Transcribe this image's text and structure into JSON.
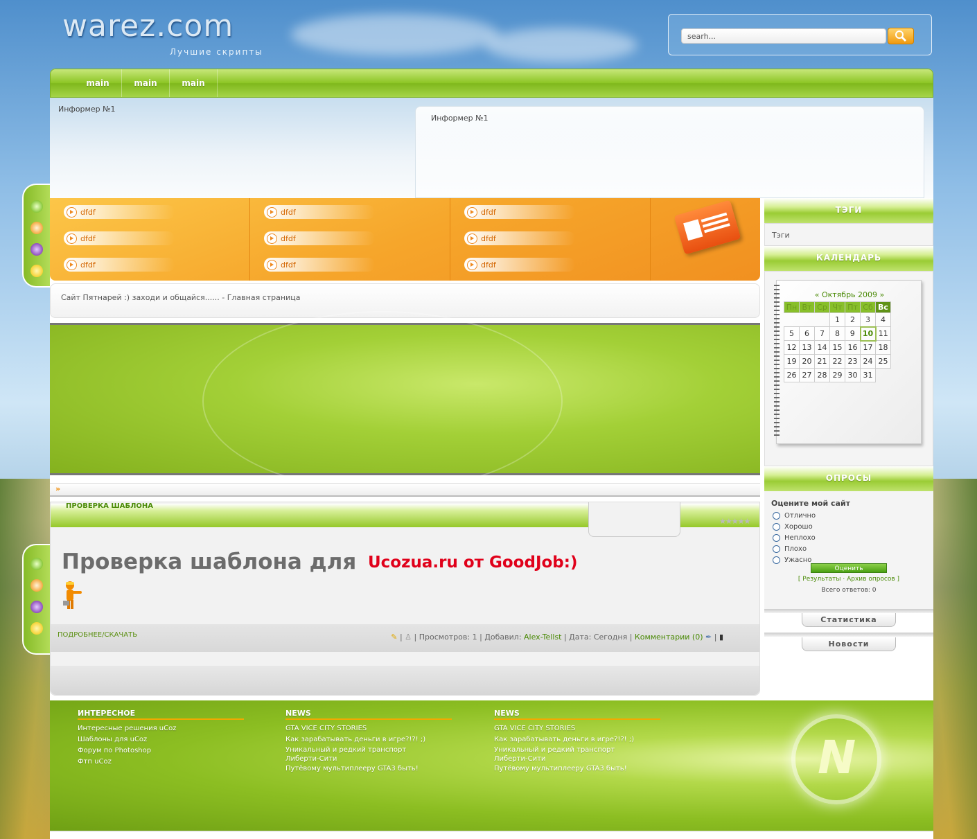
{
  "header": {
    "logo_text": "warez.com",
    "tagline": "Лучшие скрипты",
    "search_placeholder": "searh..."
  },
  "nav": {
    "items": [
      {
        "label": "main"
      },
      {
        "label": "main"
      },
      {
        "label": "main"
      }
    ]
  },
  "banner": {
    "informer_left": "Информер №1",
    "informer_right": "Информер №1"
  },
  "quick_links": {
    "columns": [
      [
        "dfdf",
        "dfdf",
        "dfdf"
      ],
      [
        "dfdf",
        "dfdf",
        "dfdf"
      ],
      [
        "dfdf",
        "dfdf",
        "dfdf"
      ]
    ]
  },
  "breadcrumb": "Сайт Пятнарей :) заходи и общайся...... - Главная страница",
  "strip_marker": "»",
  "post": {
    "section_title": "ПРОВЕРКА ШАБЛОНА",
    "rating_stars": "★★★★★",
    "headline": "Проверка шаблона для",
    "headline_red": "Ucozua.ru от GoodJob:)",
    "more_link": "ПОДРОБНЕЕ/СКАЧАТЬ",
    "views_label": "Просмотров: 1",
    "added_label": "Добавил:",
    "author": "Alex-Tellst",
    "date_label": "Дата: Сегодня",
    "comments": "Комментарии (0)"
  },
  "sidebar": {
    "tags_title": "ТЭГИ",
    "tags_text": "Тэги",
    "calendar_title": "КАЛЕНДАРЬ",
    "calendar_caption": "«  Октябрь 2009  »",
    "weekdays": [
      "Пн",
      "Вт",
      "Ср",
      "Чт",
      "Пт",
      "Сб",
      "Вс"
    ],
    "today": "10",
    "weeks": [
      [
        "",
        "",
        "",
        "1",
        "2",
        "3",
        "4"
      ],
      [
        "5",
        "6",
        "7",
        "8",
        "9",
        "10",
        "11"
      ],
      [
        "12",
        "13",
        "14",
        "15",
        "16",
        "17",
        "18"
      ],
      [
        "19",
        "20",
        "21",
        "22",
        "23",
        "24",
        "25"
      ],
      [
        "26",
        "27",
        "28",
        "29",
        "30",
        "31",
        ""
      ]
    ],
    "polls_title": "ОПРОСЫ",
    "poll_question": "Оцените мой сайт",
    "poll_options": [
      "Отлично",
      "Хорошо",
      "Неплохо",
      "Плохо",
      "Ужасно"
    ],
    "vote_button": "Оценить",
    "results_link": "[ Результаты · Архив опросов ]",
    "total_answers": "Всего ответов: 0",
    "stats_tab": "Статистика",
    "news_tab": "Новости"
  },
  "footer": {
    "columns": [
      {
        "title": "ИНТЕРЕСНОЕ",
        "links": [
          "Интересные решения uCoz",
          "Шаблоны для uCoz",
          "Форум по Photoshop",
          "Фтп uCoz"
        ]
      },
      {
        "title": "NEWS",
        "links": [
          "GTA VICE CITY STORIES",
          "Как зарабатывать деньги в игре?!?! ;)",
          "Уникальный и редкий транспорт Либерти-Сити",
          "Путёвому мультиплееру GTA3 быть!"
        ]
      },
      {
        "title": "NEWS",
        "links": [
          "GTA VICE CITY STORIES",
          "Как зарабатывать деньги в игре?!?! ;)",
          "Уникальный и редкий транспорт Либерти-Сити",
          "Путёвому мультиплееру GTA3 быть!"
        ]
      }
    ],
    "logo_letter": "N"
  },
  "colors": {
    "accent_green": "#8cc524",
    "accent_orange": "#f6a62b",
    "headline_red": "#e0001a"
  }
}
